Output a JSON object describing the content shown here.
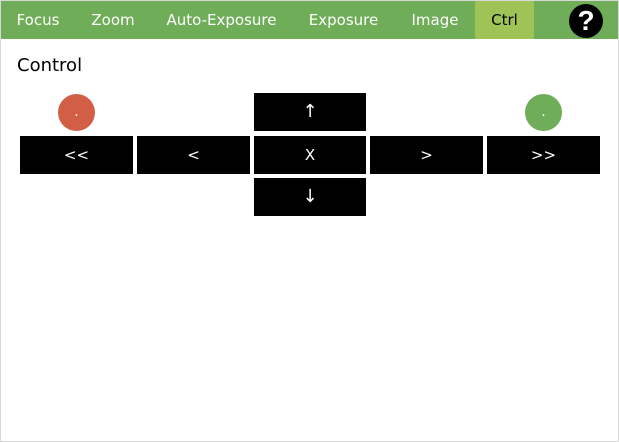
{
  "nav": {
    "tabs": [
      {
        "label": "Focus",
        "active": false
      },
      {
        "label": "Zoom",
        "active": false
      },
      {
        "label": "Auto-Exposure",
        "active": false
      },
      {
        "label": "Exposure",
        "active": false
      },
      {
        "label": "Image",
        "active": false
      },
      {
        "label": "Ctrl",
        "active": true
      }
    ],
    "help_label": "?"
  },
  "colors": {
    "nav_bg": "#6fad58",
    "active_tab": "#9fc356",
    "left_dot": "#d25f45",
    "right_dot": "#6fad58"
  },
  "control": {
    "title": "Control",
    "left_indicator": ".",
    "right_indicator": ".",
    "up": "↑",
    "down": "↓",
    "fast_left": "<<",
    "left": "<",
    "stop": "X",
    "right": ">",
    "fast_right": ">>"
  }
}
